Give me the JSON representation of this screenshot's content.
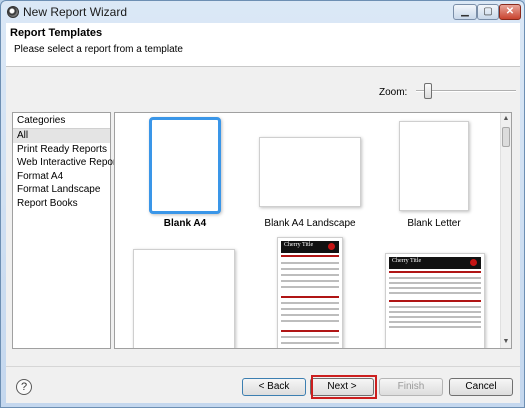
{
  "window": {
    "title": "New Report Wizard"
  },
  "header": {
    "title": "Report Templates",
    "description": "Please select a report from a template"
  },
  "zoom": {
    "label": "Zoom:",
    "level": 0.1
  },
  "categories": {
    "title": "Categories",
    "items": [
      "All",
      "Print Ready Reports",
      "Web Interactive Reports",
      "Format A4",
      "Format Landscape",
      "Report Books"
    ],
    "selected": "All"
  },
  "templates": {
    "items": [
      {
        "label": "Blank A4",
        "selected": true
      },
      {
        "label": "Blank A4 Landscape",
        "selected": false
      },
      {
        "label": "Blank Letter",
        "selected": false
      },
      {
        "label": "",
        "selected": false
      },
      {
        "label": "",
        "selected": false,
        "preview_title": "Cherry Title"
      },
      {
        "label": "",
        "selected": false,
        "preview_title": "Cherry Title"
      }
    ]
  },
  "buttons": {
    "back": "< Back",
    "next": "Next >",
    "finish": "Finish",
    "cancel": "Cancel",
    "help": "?"
  },
  "colors": {
    "selection": "#3a96e8",
    "highlight": "#cc1f1f",
    "preview_accent": "#b01515"
  }
}
